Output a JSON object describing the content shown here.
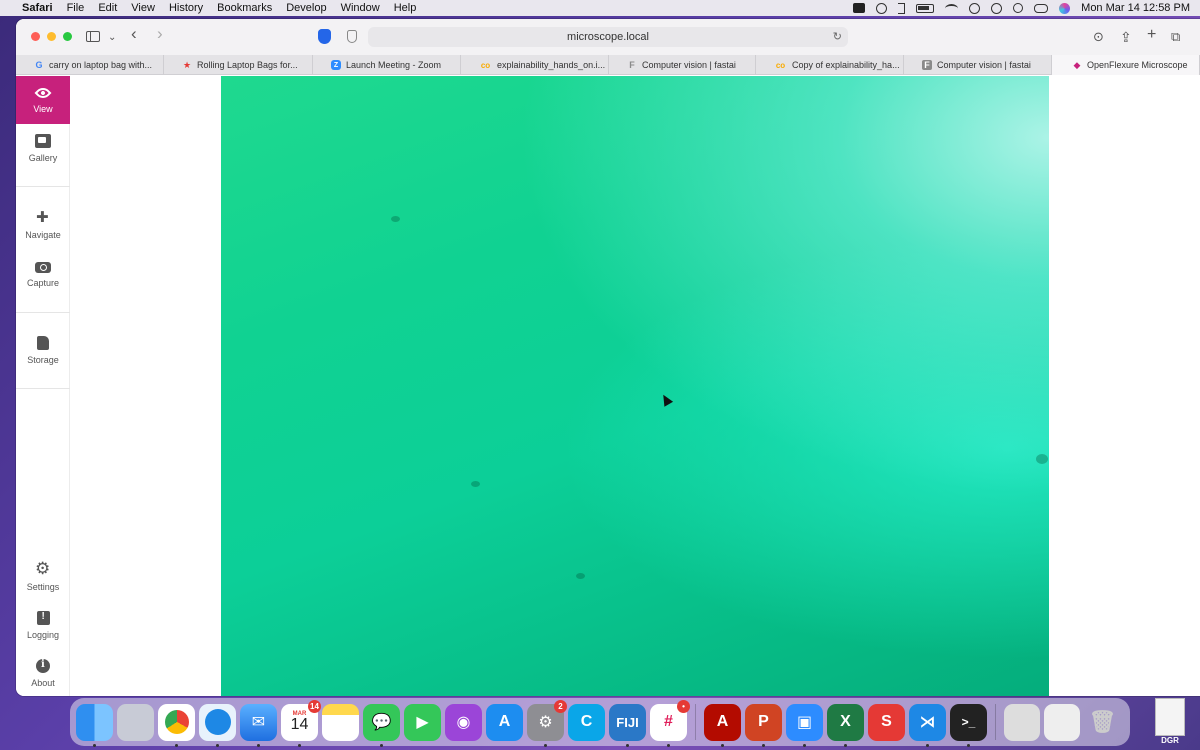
{
  "menubar": {
    "items": [
      "Safari",
      "File",
      "Edit",
      "View",
      "History",
      "Bookmarks",
      "Develop",
      "Window",
      "Help"
    ],
    "clock": "Mon Mar 14  12:58 PM"
  },
  "browser": {
    "url": "microscope.local",
    "tabs": [
      {
        "label": "carry on laptop bag with...",
        "favicon": "G",
        "color": "#4285f4"
      },
      {
        "label": "Rolling Laptop Bags for...",
        "favicon": "★",
        "color": "#e53935"
      },
      {
        "label": "Launch Meeting - Zoom",
        "favicon": "Z",
        "color": "#2d8cff"
      },
      {
        "label": "explainability_hands_on.i...",
        "favicon": "co",
        "color": "#f9ab00"
      },
      {
        "label": "Computer vision | fastai",
        "favicon": "F",
        "color": "#8a8a8a"
      },
      {
        "label": "Copy of explainability_ha...",
        "favicon": "co",
        "color": "#f9ab00"
      },
      {
        "label": "Computer vision | fastai",
        "favicon": "F",
        "color": "#8a8a8a"
      },
      {
        "label": "OpenFlexure Microscope",
        "favicon": "◆",
        "color": "#c7217c"
      }
    ]
  },
  "sidebar": {
    "items": [
      {
        "label": "View",
        "icon": "eye-icon",
        "active": true
      },
      {
        "label": "Gallery",
        "icon": "gallery-icon"
      },
      {
        "label": "Navigate",
        "icon": "gamepad-icon"
      },
      {
        "label": "Capture",
        "icon": "camera-icon"
      },
      {
        "label": "Storage",
        "icon": "sd-card-icon"
      },
      {
        "label": "Settings",
        "icon": "gear-icon"
      },
      {
        "label": "Logging",
        "icon": "clipboard-alert-icon"
      },
      {
        "label": "About",
        "icon": "info-icon"
      }
    ]
  },
  "dock": {
    "calendar_month": "MAR",
    "calendar_day": "14",
    "calendar_badge": "14",
    "settings_badge": "2",
    "slack_badge": "•",
    "trash_label": "DGR"
  },
  "colors": {
    "accent": "#c7217c",
    "stream_primary": "#10d292",
    "stream_highlight": "#b4f5eb"
  }
}
